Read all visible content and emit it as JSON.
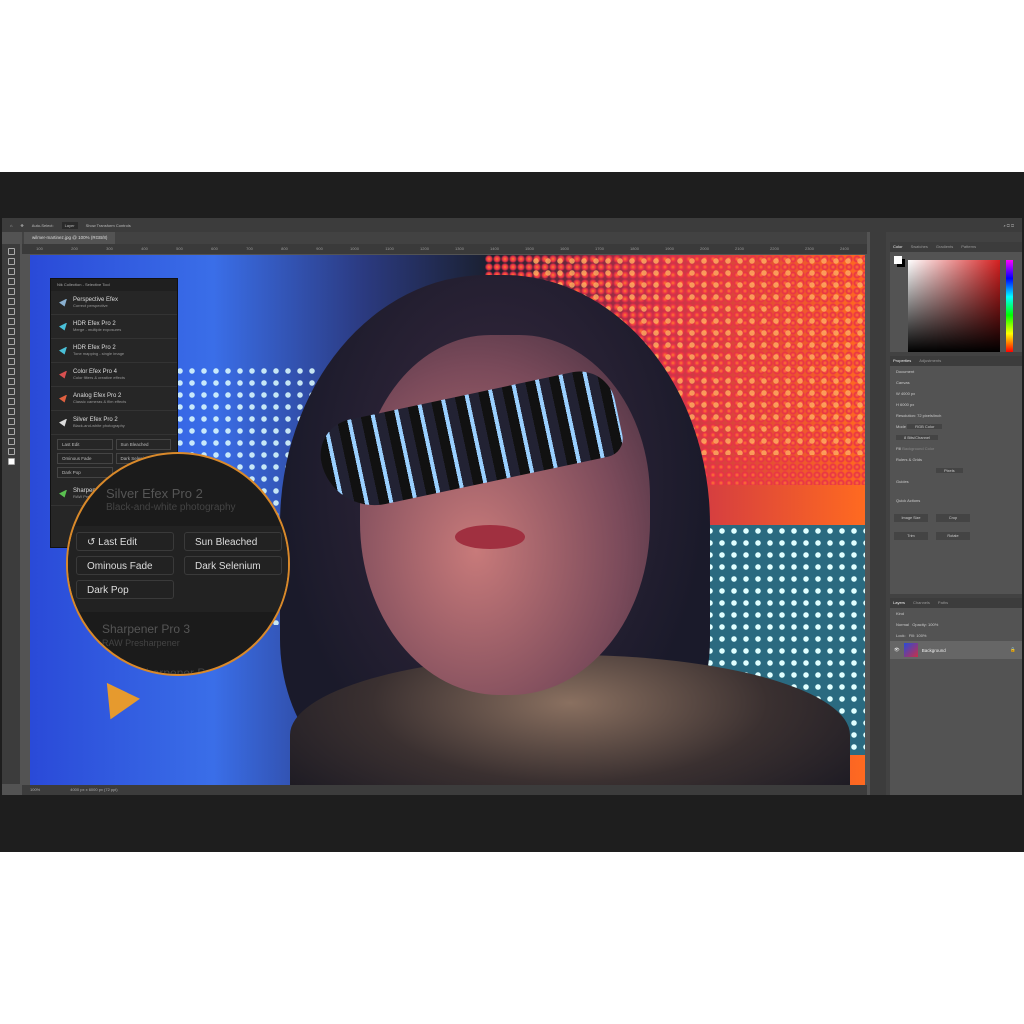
{
  "options_bar": {
    "auto_select": "Auto-Select:",
    "layer": "Layer",
    "transform": "Show Transform Controls"
  },
  "document_tab": "wilmer-martinez.jpg @ 100% (RGB/8)",
  "ruler": [
    "100",
    "200",
    "300",
    "400",
    "500",
    "600",
    "700",
    "800",
    "900",
    "1000",
    "1100",
    "1200",
    "1300",
    "1400",
    "1500",
    "1600",
    "1700",
    "1800",
    "1900",
    "2000",
    "2100",
    "2200",
    "2300",
    "2400"
  ],
  "nik_panel": {
    "title": "Nik Collection - Selective Tool",
    "items": [
      {
        "name": "Perspective Efex",
        "desc": "Correct perspective",
        "color": "#8ab0d0"
      },
      {
        "name": "HDR Efex Pro 2",
        "desc": "Merge - multiple exposures",
        "color": "#4ac0d8"
      },
      {
        "name": "HDR Efex Pro 2",
        "desc": "Tone mapping - single image",
        "color": "#4ac0d8"
      },
      {
        "name": "Color Efex Pro 4",
        "desc": "Color filters & creative effects",
        "color": "#d85050"
      },
      {
        "name": "Analog Efex Pro 2",
        "desc": "Classic cameras & film effects",
        "color": "#e06040"
      },
      {
        "name": "Silver Efex Pro 2",
        "desc": "Black-and-white photography",
        "color": "#dddddd"
      }
    ],
    "presets": [
      "Last Edit",
      "Sun Bleached",
      "Ominous Fade",
      "Dark Selenium",
      "Dark Pop"
    ],
    "below": [
      {
        "name": "Sharpener Pro 3",
        "desc": "RAW Presharpener",
        "color": "#5ac050"
      }
    ]
  },
  "magnifier": {
    "title": "Silver Efex Pro 2",
    "subtitle": "Black-and-white photography",
    "presets": [
      "Last Edit",
      "Sun Bleached",
      "Ominous Fade",
      "Dark Selenium",
      "Dark Pop"
    ],
    "next_title": "Sharpener Pro 3",
    "next_subtitle": "RAW Presharpener",
    "next2": "Sharpener Pro 3"
  },
  "status": {
    "zoom": "100%",
    "size": "4000 px x 6000 px (72 ppi)"
  },
  "color_panel": {
    "tabs": [
      "Color",
      "Swatches",
      "Gradients",
      "Patterns"
    ]
  },
  "properties": {
    "tabs": [
      "Properties",
      "Adjustments"
    ],
    "doc": "Document",
    "canvas": "Canvas",
    "w": "4000 px",
    "h": "6000 px",
    "resolution": "Resolution: 72 pixels/inch",
    "mode_label": "Mode",
    "mode": "RGB Color",
    "depth": "8 Bits/Channel",
    "fill_label": "Fill",
    "fill": "Background Color",
    "rulers": "Rulers & Grids",
    "units": "Pixels",
    "guides": "Guides",
    "quick": "Quick Actions",
    "actions": [
      "Image Size",
      "Crop",
      "Trim",
      "Rotate"
    ]
  },
  "layers": {
    "tabs": [
      "Layers",
      "Channels",
      "Paths"
    ],
    "kind": "Kind",
    "blend": "Normal",
    "opacity": "Opacity: 100%",
    "lock": "Lock:",
    "fill": "Fill: 100%",
    "layer": "Background"
  }
}
